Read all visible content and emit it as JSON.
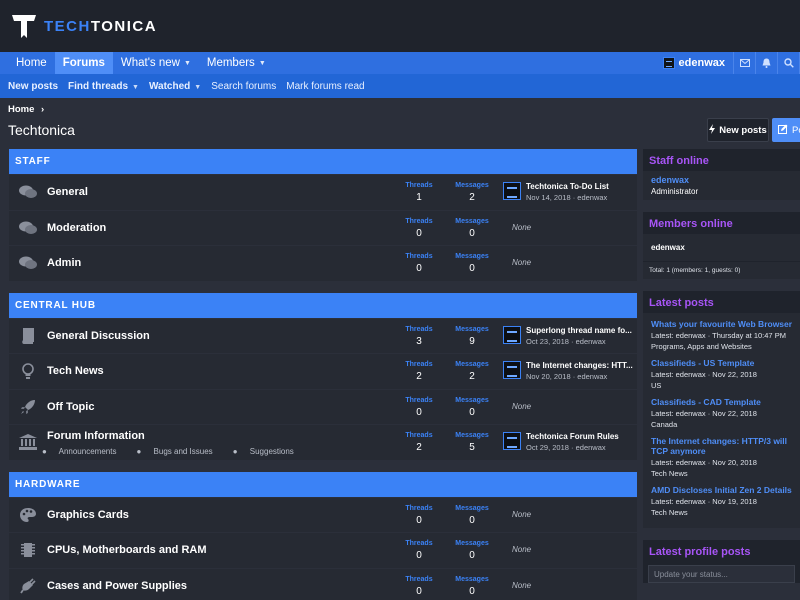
{
  "brand": {
    "text_a": "TECH",
    "text_b": "TONICA"
  },
  "nav": {
    "items": [
      {
        "label": "Home",
        "active": false,
        "dropdown": false
      },
      {
        "label": "Forums",
        "active": true,
        "dropdown": false
      },
      {
        "label": "What's new",
        "active": false,
        "dropdown": true
      },
      {
        "label": "Members",
        "active": false,
        "dropdown": true
      }
    ],
    "user": "edenwax"
  },
  "subnav": {
    "items": [
      {
        "label": "New posts"
      },
      {
        "label": "Find threads"
      },
      {
        "label": "Watched"
      },
      {
        "label": "Search forums"
      },
      {
        "label": "Mark forums read"
      }
    ]
  },
  "breadcrumb": "Home",
  "page_title": "Techtonica",
  "actions": {
    "new_posts": "New posts",
    "post": "Po"
  },
  "labels": {
    "threads": "Threads",
    "messages": "Messages",
    "none": "None"
  },
  "categories": [
    {
      "title": "STAFF",
      "forums": [
        {
          "name": "General",
          "icon": "comments-icon",
          "threads": "1",
          "messages": "2",
          "last_title": "Techtonica To-Do List",
          "last_meta": "Nov 14, 2018 · edenwax"
        },
        {
          "name": "Moderation",
          "icon": "comments-icon",
          "threads": "0",
          "messages": "0"
        },
        {
          "name": "Admin",
          "icon": "comments-icon",
          "threads": "0",
          "messages": "0"
        }
      ]
    },
    {
      "title": "CENTRAL HUB",
      "forums": [
        {
          "name": "General Discussion",
          "icon": "book-icon",
          "threads": "3",
          "messages": "9",
          "last_title": "Superlong thread name fo...",
          "last_meta": "Oct 23, 2018 · edenwax"
        },
        {
          "name": "Tech News",
          "icon": "lightbulb-icon",
          "threads": "2",
          "messages": "2",
          "last_title": "The Internet changes: HTT...",
          "last_meta": "Nov 20, 2018 · edenwax"
        },
        {
          "name": "Off Topic",
          "icon": "rocket-icon",
          "threads": "0",
          "messages": "0"
        },
        {
          "name": "Forum Information",
          "icon": "institution-icon",
          "threads": "2",
          "messages": "5",
          "last_title": "Techtonica Forum Rules",
          "last_meta": "Oct 29, 2018 · edenwax",
          "subforums": [
            "Announcements",
            "Bugs and Issues",
            "Suggestions"
          ]
        }
      ]
    },
    {
      "title": "HARDWARE",
      "forums": [
        {
          "name": "Graphics Cards",
          "icon": "palette-icon",
          "threads": "0",
          "messages": "0"
        },
        {
          "name": "CPUs, Motherboards and RAM",
          "icon": "chip-icon",
          "threads": "0",
          "messages": "0"
        },
        {
          "name": "Cases and Power Supplies",
          "icon": "plug-icon",
          "threads": "0",
          "messages": "0"
        }
      ]
    }
  ],
  "sidebar": {
    "staff_online": {
      "title": "Staff online",
      "name": "edenwax",
      "role": "Administrator"
    },
    "members_online": {
      "title": "Members online",
      "name": "edenwax",
      "total": "Total: 1 (members: 1, guests: 0)"
    },
    "latest_posts": {
      "title": "Latest posts",
      "items": [
        {
          "title": "Whats your favourite Web Browser",
          "meta": "Latest: edenwax · Thursday at 10:47 PM",
          "forum": "Programs, Apps and Websites"
        },
        {
          "title": "Classifieds - US Template",
          "meta": "Latest: edenwax · Nov 22, 2018",
          "forum": "US"
        },
        {
          "title": "Classifieds - CAD Template",
          "meta": "Latest: edenwax · Nov 22, 2018",
          "forum": "Canada"
        },
        {
          "title": "The Internet changes: HTTP/3 will",
          "title2": "TCP anymore",
          "meta": "Latest: edenwax · Nov 20, 2018",
          "forum": "Tech News"
        },
        {
          "title": "AMD Discloses Initial Zen 2 Details",
          "meta": "Latest: edenwax · Nov 19, 2018",
          "forum": "Tech News"
        }
      ]
    },
    "latest_profile_posts": {
      "title": "Latest profile posts",
      "placeholder": "Update your status..."
    }
  }
}
